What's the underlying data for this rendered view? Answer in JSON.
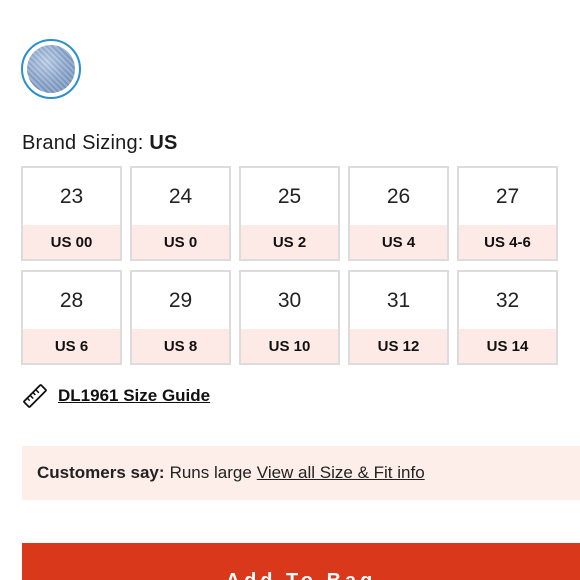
{
  "brand_sizing": {
    "label": "Brand Sizing:",
    "value": "US"
  },
  "sizes": [
    {
      "num": "23",
      "us": "US 00"
    },
    {
      "num": "24",
      "us": "US 0"
    },
    {
      "num": "25",
      "us": "US 2"
    },
    {
      "num": "26",
      "us": "US 4"
    },
    {
      "num": "27",
      "us": "US 4-6"
    },
    {
      "num": "28",
      "us": "US 6"
    },
    {
      "num": "29",
      "us": "US 8"
    },
    {
      "num": "30",
      "us": "US 10"
    },
    {
      "num": "31",
      "us": "US 12"
    },
    {
      "num": "32",
      "us": "US 14"
    }
  ],
  "size_guide": {
    "label": "DL1961 Size Guide",
    "icon": "ruler-icon"
  },
  "fit_info": {
    "label": "Customers say:",
    "value": "Runs large",
    "link": "View all Size & Fit info"
  },
  "add_button": {
    "label": "Add To Bag"
  },
  "colors": {
    "accent": "#d9381b",
    "highlight_bg": "#fdeae6",
    "swatch_ring": "#2a8fd0"
  }
}
